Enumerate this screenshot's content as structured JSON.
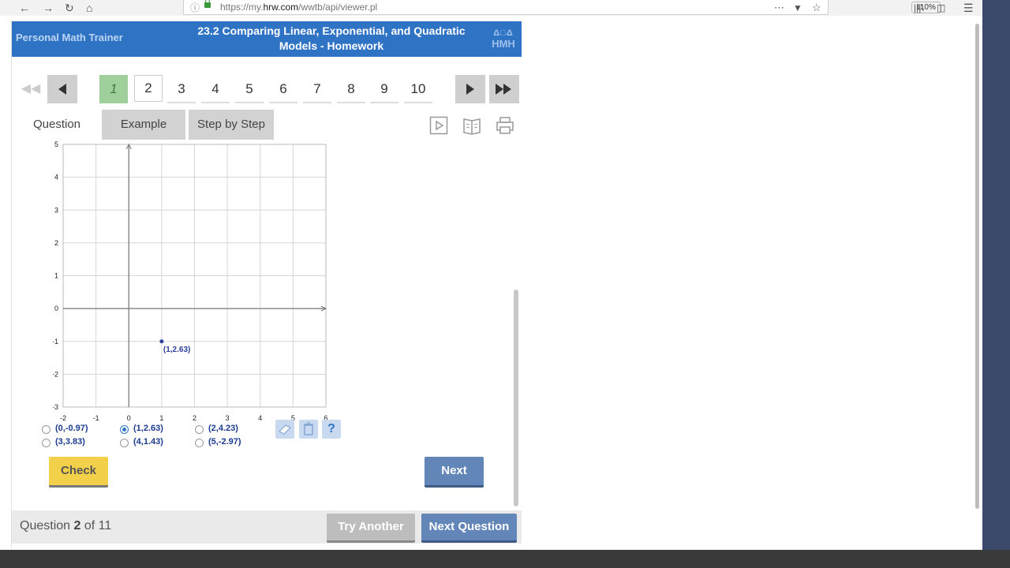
{
  "browser": {
    "url_prefix": "https://my.",
    "url_domain": "hrw.com",
    "url_path": "/wwtb/api/viewer.pl",
    "zoom": "110%"
  },
  "header": {
    "brand": "Personal Math Trainer",
    "title_line1": "23.2 Comparing Linear, Exponential, and Quadratic",
    "title_line2": "Models - Homework",
    "logo": "HMH"
  },
  "pager": {
    "pages": [
      "1",
      "2",
      "3",
      "4",
      "5",
      "6",
      "7",
      "8",
      "9",
      "10"
    ],
    "completed_page": "1",
    "selected_page": "2"
  },
  "tabs": {
    "question": "Question",
    "example": "Example",
    "step_by_step": "Step by Step"
  },
  "chart_data": {
    "type": "scatter",
    "x_ticks": [
      "-2",
      "-1",
      "0",
      "1",
      "2",
      "3",
      "4",
      "5",
      "6"
    ],
    "y_ticks": [
      "5",
      "4",
      "3",
      "2",
      "1",
      "0",
      "-1",
      "-2",
      "-3"
    ],
    "xlim": [
      -2,
      6
    ],
    "ylim": [
      -3,
      5
    ],
    "grid": true,
    "points": [
      {
        "x": 1,
        "y": -1,
        "label": "(1,2.63)"
      }
    ]
  },
  "choices": [
    {
      "label": "(0,-0.97)",
      "selected": false
    },
    {
      "label": "(3,3.83)",
      "selected": false
    },
    {
      "label": "(1,2.63)",
      "selected": true
    },
    {
      "label": "(4,1.43)",
      "selected": false
    },
    {
      "label": "(2,4.23)",
      "selected": false
    },
    {
      "label": "(5,-2.97)",
      "selected": false
    }
  ],
  "buttons": {
    "check": "Check",
    "next": "Next",
    "try_another": "Try Another",
    "next_question": "Next Question",
    "help": "?"
  },
  "footer": {
    "question_word": "Question",
    "current": "2",
    "of_total": "of 11"
  },
  "colors": {
    "header_blue": "#2f73c5",
    "check_yellow": "#f2d04a",
    "next_blue": "#6386b9",
    "point_blue": "#2a3f9e"
  }
}
